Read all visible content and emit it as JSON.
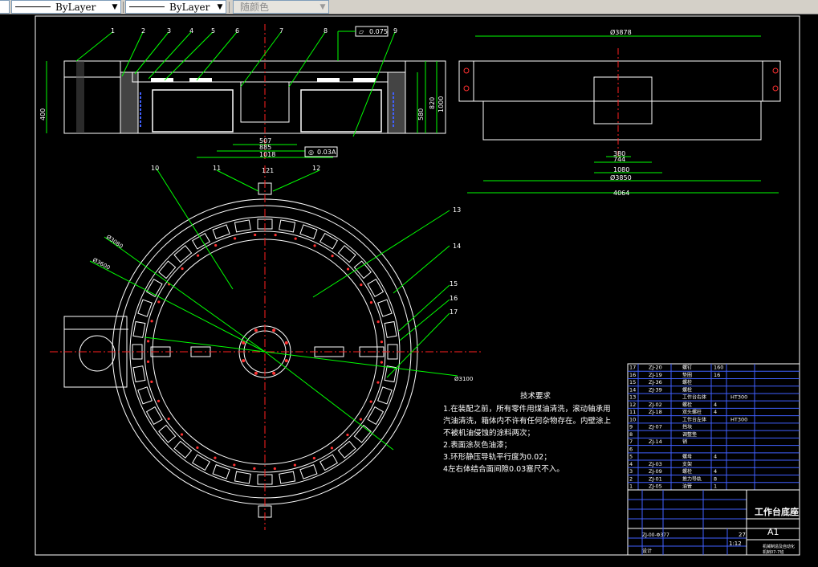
{
  "toolbar": {
    "linetype": "ByLayer",
    "lineweight": "ByLayer",
    "color": "随颜色"
  },
  "top_view": {
    "balloons": [
      "1",
      "2",
      "3",
      "4",
      "5",
      "6",
      "7",
      "8",
      "9"
    ],
    "flatness_tol": "0.075",
    "dims": {
      "height_left": "400",
      "d_507": "507",
      "d_885": "885",
      "d_1018": "1018",
      "position_tol": "0.03",
      "datum": "A",
      "h_580": "580",
      "h_820": "820",
      "h_1000": "1000"
    }
  },
  "side_view": {
    "dims": {
      "top_width": "Ø3878",
      "d_380": "380",
      "d_744": "744",
      "d_1080": "1080",
      "d_3850": "Ø3850",
      "d_4064": "4064"
    }
  },
  "plan_view": {
    "balloons": {
      "b10": "10",
      "b11": "11",
      "b12": "12",
      "b13": "13",
      "b14": "14",
      "b15": "15",
      "b16": "16",
      "b17": "17"
    },
    "dims": {
      "d_top": "121",
      "dia_a": "Ø3080",
      "dia_b": "Ø3600",
      "dia_c": "Ø3100"
    }
  },
  "notes": {
    "heading": "技术要求",
    "lines": [
      "1.在装配之前，所有零件用煤油清洗，滚动轴承用",
      "汽油清洗，箱体内不许有任何杂物存在。内壁涂上",
      "不被机油侵蚀的涂料两次；",
      "2.表面涂灰色油漆；",
      "3.环形静压导轨平行度为0.02；",
      "4左右体结合面间隙0.03塞尺不入。"
    ]
  },
  "bom": {
    "rows": [
      {
        "no": "17",
        "code": "ZJ-20",
        "name": "螺钉",
        "qty": "160",
        "mat": ""
      },
      {
        "no": "16",
        "code": "ZJ-19",
        "name": "垫圈",
        "qty": "16",
        "mat": ""
      },
      {
        "no": "15",
        "code": "ZJ-36",
        "name": "螺栓",
        "qty": "",
        "mat": ""
      },
      {
        "no": "14",
        "code": "ZJ-39",
        "name": "螺栓",
        "qty": "",
        "mat": ""
      },
      {
        "no": "13",
        "code": "",
        "name": "工作台右体",
        "qty": "",
        "mat": "HT300"
      },
      {
        "no": "12",
        "code": "ZJ-02",
        "name": "螺栓",
        "qty": "4",
        "mat": ""
      },
      {
        "no": "11",
        "code": "ZJ-18",
        "name": "双头螺柱",
        "qty": "4",
        "mat": ""
      },
      {
        "no": "10",
        "code": "",
        "name": "工作台左体",
        "qty": "",
        "mat": "HT300"
      },
      {
        "no": "9",
        "code": "ZJ-07",
        "name": "挡块",
        "qty": "",
        "mat": ""
      },
      {
        "no": "8",
        "code": "",
        "name": "调整垫",
        "qty": "",
        "mat": ""
      },
      {
        "no": "7",
        "code": "ZJ-14",
        "name": "销",
        "qty": "",
        "mat": ""
      },
      {
        "no": "6",
        "code": "",
        "name": "",
        "qty": "",
        "mat": ""
      },
      {
        "no": "5",
        "code": "",
        "name": "螺母",
        "qty": "4",
        "mat": ""
      },
      {
        "no": "4",
        "code": "ZJ-03",
        "name": "支架",
        "qty": "",
        "mat": ""
      },
      {
        "no": "3",
        "code": "ZJ-09",
        "name": "螺栓",
        "qty": "4",
        "mat": ""
      },
      {
        "no": "2",
        "code": "ZJ-01",
        "name": "推力导轨",
        "qty": "8",
        "mat": ""
      },
      {
        "no": "1",
        "code": "ZJ-05",
        "name": "油管",
        "qty": "1",
        "mat": ""
      }
    ]
  },
  "title_block": {
    "title": "工作台底座",
    "size": "A1",
    "scale": "1:12",
    "sheet": "27",
    "drawing_no": "ZJ-00-Φ377",
    "designer": "设计",
    "school": "机械制造及自动化",
    "class_no": "机制07-7班"
  }
}
